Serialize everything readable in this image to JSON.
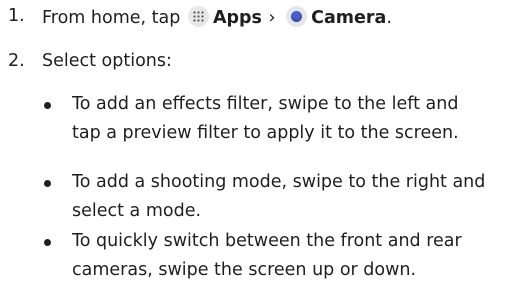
{
  "steps": [
    {
      "number": "1.",
      "prefix": "From home, tap",
      "apps_label": "Apps",
      "arrow": "›",
      "camera_label": "Camera",
      "suffix": "."
    },
    {
      "number": "2.",
      "text": "Select options:"
    }
  ],
  "bullets": [
    {
      "text": "To add an effects filter, swipe to the left and\ntap a preview filter to apply it to the screen."
    },
    {
      "text": "To add a shooting mode, swipe to the right and\nselect a mode."
    },
    {
      "text": "To quickly switch between the front and rear\ncameras, swipe the screen up or down."
    }
  ],
  "icons": {
    "apps": "apps-grid-icon",
    "camera": "camera-app-icon"
  },
  "colors": {
    "text": "#1f1f1f",
    "camera_lens": "#4f5ec6",
    "icon_bg": "#e8e8e8"
  }
}
